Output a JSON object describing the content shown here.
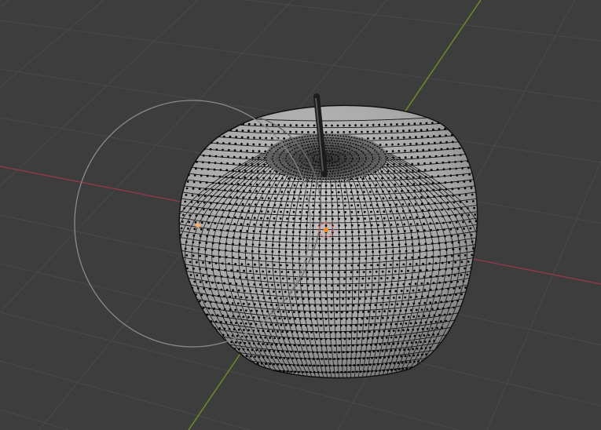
{
  "viewport": {
    "background": "#3d3d3d",
    "grid_color": "#4a4a4a",
    "x_axis_color": "#8c3a46",
    "y_axis_color": "#6b8e23",
    "mesh_fill": "#a9a9a9",
    "wire_color": "#151515",
    "light_gizmo_color": "#8a8a8a",
    "origin_color": "#ff8c1a"
  },
  "object": {
    "type": "mesh",
    "shape": "apple",
    "display": "wireframe-overlay"
  }
}
